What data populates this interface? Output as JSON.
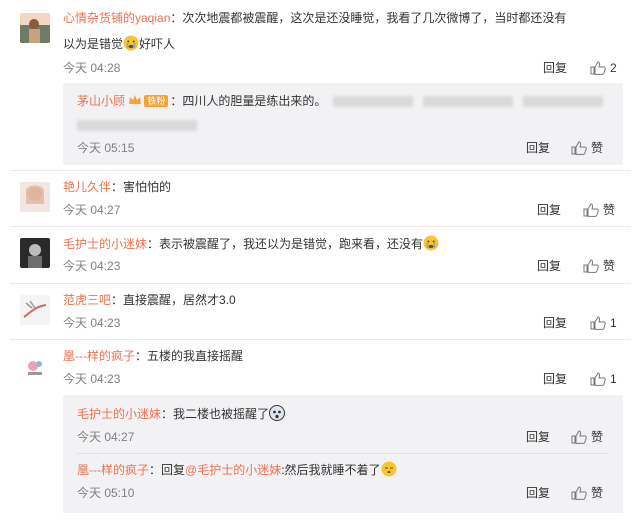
{
  "comments": [
    {
      "user": "心情杂货铺的yaqian",
      "text_line1": "：次次地震都被震醒，这次是还没睡觉，我看了几次微博了，当时都还没有",
      "text_line2": "以为是错觉",
      "text_line2_after": "好吓人",
      "time": "今天 04:28",
      "reply_label": "回复",
      "like_count": "2"
    },
    {
      "user": "艳儿久伴",
      "text_line1": "：害怕怕的",
      "time": "今天 04:27",
      "reply_label": "回复",
      "like_label": "赞"
    },
    {
      "user": "毛护士的小迷妹",
      "text_line1": "：表示被震醒了，我还以为是错觉，跑来看，还没有",
      "time": "今天 04:23",
      "reply_label": "回复",
      "like_label": "赞"
    },
    {
      "user": "范虎三吧",
      "text_line1": "：直接震醒，居然才3.0",
      "time": "今天 04:23",
      "reply_label": "回复",
      "like_count": "1"
    },
    {
      "user": "凰---样的疯子",
      "text_line1": "：五楼的我直接摇醒",
      "time": "今天 04:23",
      "reply_label": "回复",
      "like_count": "1"
    }
  ],
  "replies": [
    {
      "user": "茅山小顾",
      "badge": "铁粉",
      "text": "：四川人的胆量是练出来的。",
      "time": "今天 05:15",
      "reply_label": "回复",
      "like_label": "赞"
    },
    {
      "user": "毛护士的小迷妹",
      "text": "：我二楼也被摇醒了",
      "time": "今天 04:27",
      "reply_label": "回复",
      "like_label": "赞"
    },
    {
      "user": "凰---样的疯子",
      "text_pre": "：回复",
      "mention": "@毛护士的小迷妹",
      "text_post": ":然后我就睡不着了",
      "time": "今天 05:10",
      "reply_label": "回复",
      "like_label": "赞"
    }
  ],
  "colors": {
    "username": "#eb7350",
    "time": "#808080",
    "reply_bg": "#f2f2f5"
  }
}
